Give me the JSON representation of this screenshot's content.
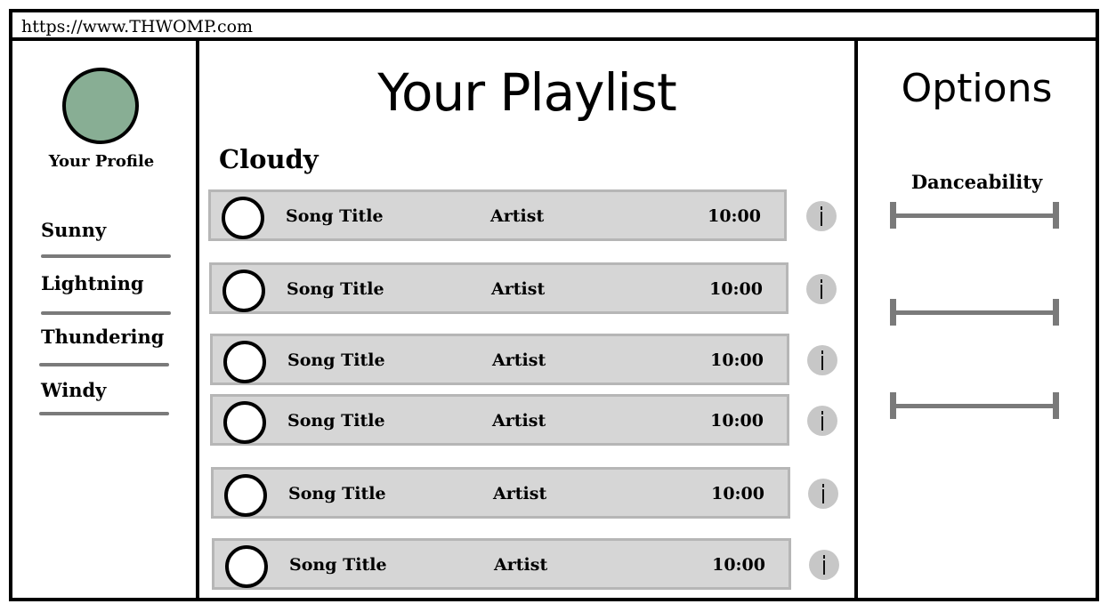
{
  "browser": {
    "url": "https://www.THWOMP.com"
  },
  "sidebar": {
    "profile_label": "Your Profile",
    "items": [
      {
        "label": "Sunny"
      },
      {
        "label": "Lightning"
      },
      {
        "label": "Thundering"
      },
      {
        "label": "Windy"
      }
    ]
  },
  "main": {
    "title": "Your Playlist",
    "playlist_name": "Cloudy",
    "songs": [
      {
        "title": "Song Title",
        "artist": "Artist",
        "duration": "10:00"
      },
      {
        "title": "Song Title",
        "artist": "Artist",
        "duration": "10:00"
      },
      {
        "title": "Song Title",
        "artist": "Artist",
        "duration": "10:00"
      },
      {
        "title": "Song Title",
        "artist": "Artist",
        "duration": "10:00"
      },
      {
        "title": "Song Title",
        "artist": "Artist",
        "duration": "10:00"
      },
      {
        "title": "Song Title",
        "artist": "Artist",
        "duration": "10:00"
      }
    ]
  },
  "options": {
    "title": "Options",
    "danceability_label": "Danceability"
  },
  "colors": {
    "avatar": "#88ae94",
    "row_background": "#d6d6d6",
    "row_border": "#b6b6b6",
    "slider": "#7a7a7a",
    "info_button": "#c7c7c7"
  },
  "icons": {
    "avatar": "profile-avatar-icon",
    "play": "circle-icon",
    "info": "info-icon"
  }
}
